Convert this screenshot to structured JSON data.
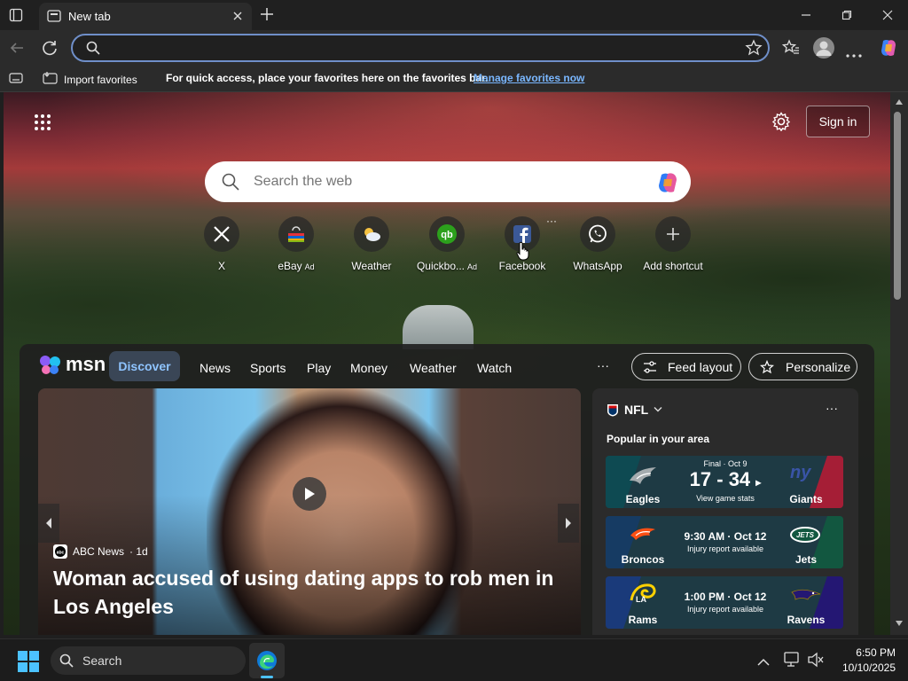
{
  "browser": {
    "tab_title": "New tab",
    "address_value": "",
    "favorites_bar": {
      "import_label": "Import favorites",
      "message": "For quick access, place your favorites here on the favorites bar.",
      "manage_link": "Manage favorites now"
    }
  },
  "newtab": {
    "signin_label": "Sign in",
    "search_placeholder": "Search the web",
    "shortcuts": [
      {
        "label": "X",
        "ad": "",
        "icon": "x-logo-icon"
      },
      {
        "label": "eBay",
        "ad": "Ad",
        "icon": "ebay-bag-icon"
      },
      {
        "label": "Weather",
        "ad": "",
        "icon": "weather-icon"
      },
      {
        "label": "Quickbo...",
        "ad": "Ad",
        "icon": "quickbooks-icon"
      },
      {
        "label": "Facebook",
        "ad": "",
        "icon": "facebook-icon"
      },
      {
        "label": "WhatsApp",
        "ad": "",
        "icon": "whatsapp-icon"
      },
      {
        "label": "Add shortcut",
        "ad": "",
        "icon": "plus-icon"
      }
    ]
  },
  "feed": {
    "brand": "msn",
    "nav": [
      "Discover",
      "News",
      "Sports",
      "Play",
      "Money",
      "Weather",
      "Watch"
    ],
    "more_label": "···",
    "feed_layout_label": "Feed layout",
    "personalize_label": "Personalize",
    "hero": {
      "source": "ABC News",
      "age": "· 1d",
      "headline_line1": "Woman accused of using dating apps to rob men in",
      "headline_line2": "Los Angeles"
    },
    "nfl": {
      "title": "NFL",
      "subtitle": "Popular in your area",
      "games": [
        {
          "team1": "Eagles",
          "team2": "Giants",
          "top": "Final · Oct 9",
          "main": "17 - 34",
          "sub": "View game stats",
          "color1": "#0e4a52",
          "color2": "#a51e36"
        },
        {
          "team1": "Broncos",
          "team2": "Jets",
          "top": "",
          "main": "9:30 AM · Oct 12",
          "sub": "Injury report available",
          "color1": "#163b63",
          "color2": "#125740"
        },
        {
          "team1": "Rams",
          "team2": "Ravens",
          "top": "",
          "main": "1:00 PM · Oct 12",
          "sub": "Injury report available",
          "color1": "#1a3a7a",
          "color2": "#241773"
        }
      ]
    }
  },
  "taskbar": {
    "search_label": "Search",
    "time": "6:50 PM",
    "date": "10/10/2025"
  },
  "colors": {
    "accent_blue": "#6f8fc9",
    "discover_text": "#8fc4ff",
    "link": "#7ab7ff"
  }
}
